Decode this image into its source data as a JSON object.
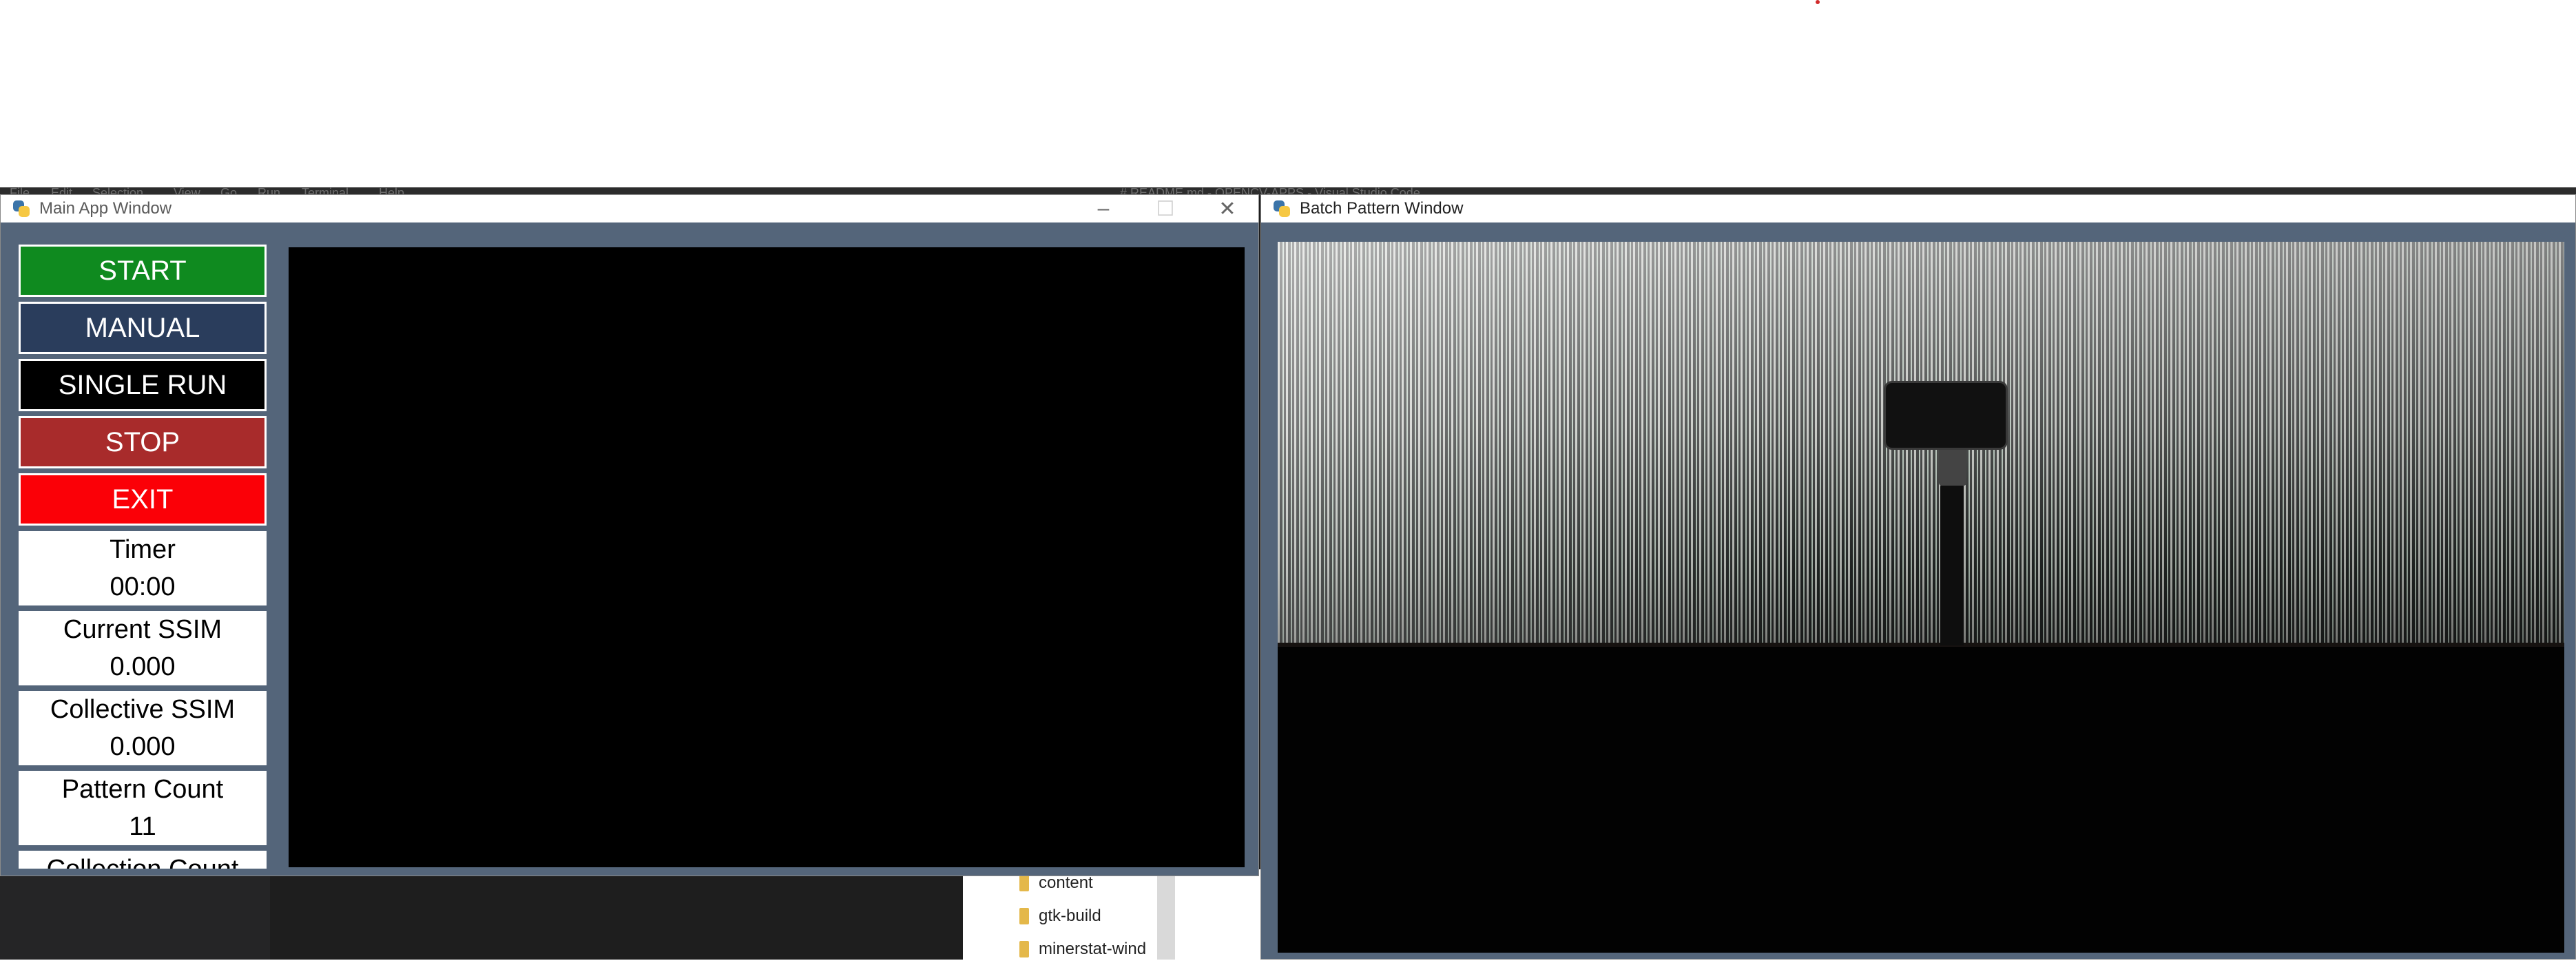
{
  "background_editor": {
    "menu": [
      "File",
      "Edit",
      "Selection",
      "View",
      "Go",
      "Run",
      "Terminal",
      "Help"
    ],
    "title_fragment": "# README.md - OPENCV-APPS - Visual Studio Code",
    "explorer_items": [
      "content",
      "gtk-build",
      "minerstat-wind"
    ]
  },
  "main_window": {
    "title": "Main App Window",
    "minimize_icon": "minimize-icon",
    "maximize_icon": "maximize-icon",
    "close_icon": "close-icon",
    "buttons": {
      "start": "START",
      "manual": "MANUAL",
      "single_run": "SINGLE RUN",
      "stop": "STOP",
      "exit": "EXIT"
    },
    "button_colors": {
      "start": "#0f8a1f",
      "manual": "#2a3d5c",
      "single_run": "#000000",
      "stop": "#a82b2b",
      "exit": "#fb0007"
    },
    "stats": {
      "timer_label": "Timer",
      "timer_value": "00:00",
      "current_ssim_label": "Current SSIM",
      "current_ssim_value": "0.000",
      "collective_ssim_label": "Collective SSIM",
      "collective_ssim_value": "0.000",
      "pattern_count_label": "Pattern Count",
      "pattern_count_value": "11",
      "collection_count_label": "Collection Count"
    }
  },
  "batch_window": {
    "title": "Batch Pattern Window"
  }
}
